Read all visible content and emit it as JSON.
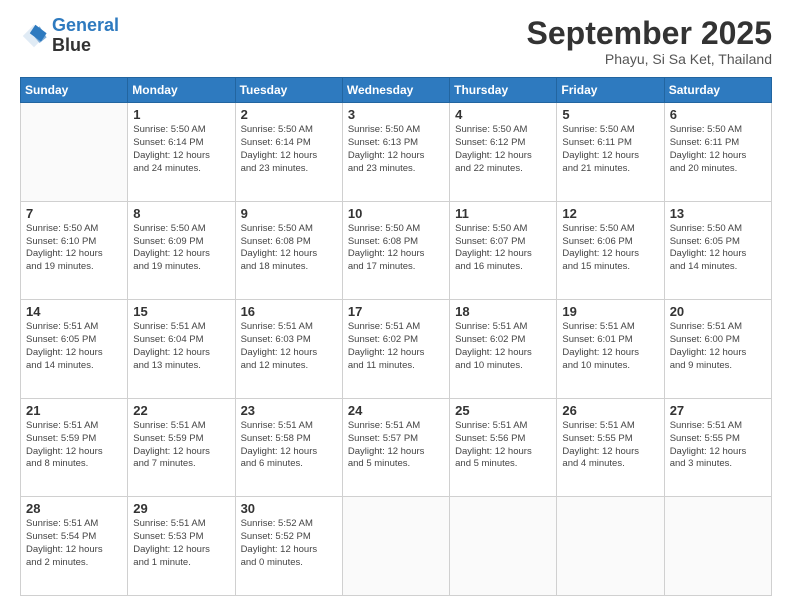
{
  "logo": {
    "line1": "General",
    "line2": "Blue"
  },
  "title": "September 2025",
  "subtitle": "Phayu, Si Sa Ket, Thailand",
  "weekdays": [
    "Sunday",
    "Monday",
    "Tuesday",
    "Wednesday",
    "Thursday",
    "Friday",
    "Saturday"
  ],
  "weeks": [
    [
      {
        "day": "",
        "info": ""
      },
      {
        "day": "1",
        "info": "Sunrise: 5:50 AM\nSunset: 6:14 PM\nDaylight: 12 hours\nand 24 minutes."
      },
      {
        "day": "2",
        "info": "Sunrise: 5:50 AM\nSunset: 6:14 PM\nDaylight: 12 hours\nand 23 minutes."
      },
      {
        "day": "3",
        "info": "Sunrise: 5:50 AM\nSunset: 6:13 PM\nDaylight: 12 hours\nand 23 minutes."
      },
      {
        "day": "4",
        "info": "Sunrise: 5:50 AM\nSunset: 6:12 PM\nDaylight: 12 hours\nand 22 minutes."
      },
      {
        "day": "5",
        "info": "Sunrise: 5:50 AM\nSunset: 6:11 PM\nDaylight: 12 hours\nand 21 minutes."
      },
      {
        "day": "6",
        "info": "Sunrise: 5:50 AM\nSunset: 6:11 PM\nDaylight: 12 hours\nand 20 minutes."
      }
    ],
    [
      {
        "day": "7",
        "info": "Sunrise: 5:50 AM\nSunset: 6:10 PM\nDaylight: 12 hours\nand 19 minutes."
      },
      {
        "day": "8",
        "info": "Sunrise: 5:50 AM\nSunset: 6:09 PM\nDaylight: 12 hours\nand 19 minutes."
      },
      {
        "day": "9",
        "info": "Sunrise: 5:50 AM\nSunset: 6:08 PM\nDaylight: 12 hours\nand 18 minutes."
      },
      {
        "day": "10",
        "info": "Sunrise: 5:50 AM\nSunset: 6:08 PM\nDaylight: 12 hours\nand 17 minutes."
      },
      {
        "day": "11",
        "info": "Sunrise: 5:50 AM\nSunset: 6:07 PM\nDaylight: 12 hours\nand 16 minutes."
      },
      {
        "day": "12",
        "info": "Sunrise: 5:50 AM\nSunset: 6:06 PM\nDaylight: 12 hours\nand 15 minutes."
      },
      {
        "day": "13",
        "info": "Sunrise: 5:50 AM\nSunset: 6:05 PM\nDaylight: 12 hours\nand 14 minutes."
      }
    ],
    [
      {
        "day": "14",
        "info": "Sunrise: 5:51 AM\nSunset: 6:05 PM\nDaylight: 12 hours\nand 14 minutes."
      },
      {
        "day": "15",
        "info": "Sunrise: 5:51 AM\nSunset: 6:04 PM\nDaylight: 12 hours\nand 13 minutes."
      },
      {
        "day": "16",
        "info": "Sunrise: 5:51 AM\nSunset: 6:03 PM\nDaylight: 12 hours\nand 12 minutes."
      },
      {
        "day": "17",
        "info": "Sunrise: 5:51 AM\nSunset: 6:02 PM\nDaylight: 12 hours\nand 11 minutes."
      },
      {
        "day": "18",
        "info": "Sunrise: 5:51 AM\nSunset: 6:02 PM\nDaylight: 12 hours\nand 10 minutes."
      },
      {
        "day": "19",
        "info": "Sunrise: 5:51 AM\nSunset: 6:01 PM\nDaylight: 12 hours\nand 10 minutes."
      },
      {
        "day": "20",
        "info": "Sunrise: 5:51 AM\nSunset: 6:00 PM\nDaylight: 12 hours\nand 9 minutes."
      }
    ],
    [
      {
        "day": "21",
        "info": "Sunrise: 5:51 AM\nSunset: 5:59 PM\nDaylight: 12 hours\nand 8 minutes."
      },
      {
        "day": "22",
        "info": "Sunrise: 5:51 AM\nSunset: 5:59 PM\nDaylight: 12 hours\nand 7 minutes."
      },
      {
        "day": "23",
        "info": "Sunrise: 5:51 AM\nSunset: 5:58 PM\nDaylight: 12 hours\nand 6 minutes."
      },
      {
        "day": "24",
        "info": "Sunrise: 5:51 AM\nSunset: 5:57 PM\nDaylight: 12 hours\nand 5 minutes."
      },
      {
        "day": "25",
        "info": "Sunrise: 5:51 AM\nSunset: 5:56 PM\nDaylight: 12 hours\nand 5 minutes."
      },
      {
        "day": "26",
        "info": "Sunrise: 5:51 AM\nSunset: 5:55 PM\nDaylight: 12 hours\nand 4 minutes."
      },
      {
        "day": "27",
        "info": "Sunrise: 5:51 AM\nSunset: 5:55 PM\nDaylight: 12 hours\nand 3 minutes."
      }
    ],
    [
      {
        "day": "28",
        "info": "Sunrise: 5:51 AM\nSunset: 5:54 PM\nDaylight: 12 hours\nand 2 minutes."
      },
      {
        "day": "29",
        "info": "Sunrise: 5:51 AM\nSunset: 5:53 PM\nDaylight: 12 hours\nand 1 minute."
      },
      {
        "day": "30",
        "info": "Sunrise: 5:52 AM\nSunset: 5:52 PM\nDaylight: 12 hours\nand 0 minutes."
      },
      {
        "day": "",
        "info": ""
      },
      {
        "day": "",
        "info": ""
      },
      {
        "day": "",
        "info": ""
      },
      {
        "day": "",
        "info": ""
      }
    ]
  ]
}
